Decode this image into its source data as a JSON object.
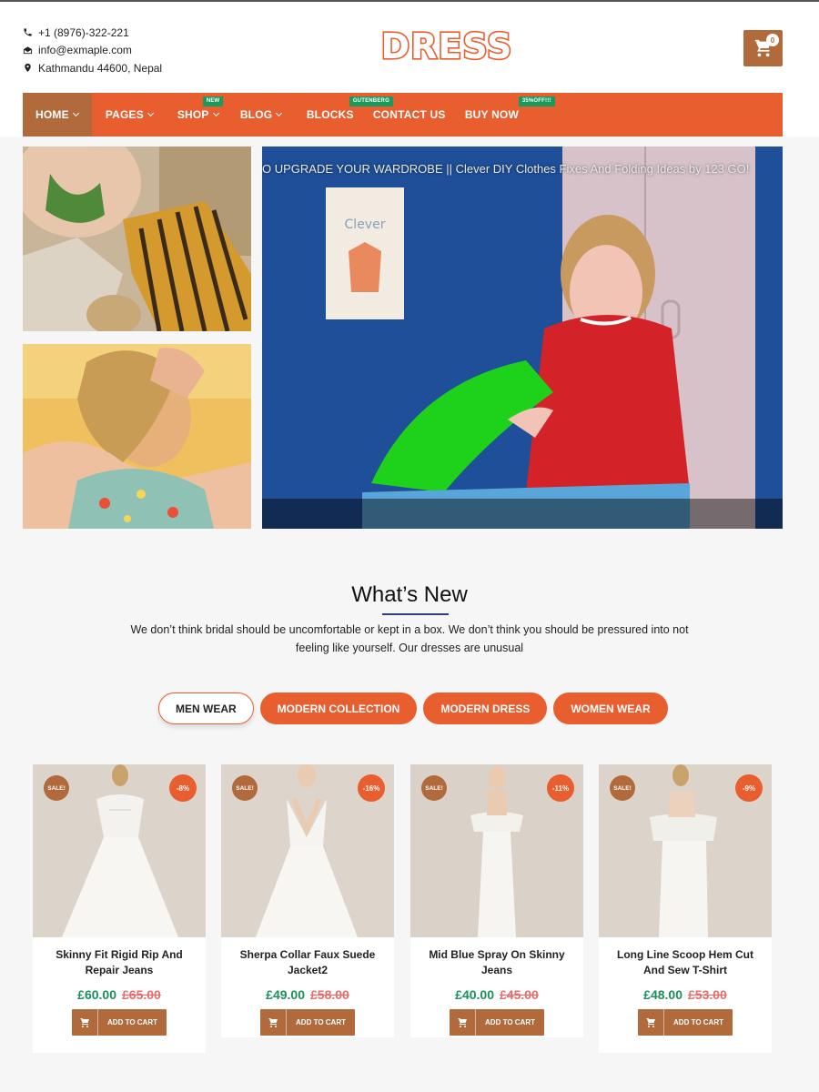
{
  "header": {
    "phone": "+1 (8976)-322-221",
    "email": "info@exmaple.com",
    "address": "Kathmandu 44600, Nepal",
    "logo_text": "DRESS",
    "cart_count": "0"
  },
  "nav": {
    "items": [
      {
        "label": "HOME",
        "dropdown": true,
        "badge": ""
      },
      {
        "label": "PAGES",
        "dropdown": true,
        "badge": ""
      },
      {
        "label": "SHOP",
        "dropdown": true,
        "badge": "NEW"
      },
      {
        "label": "BLOG",
        "dropdown": true,
        "badge": ""
      },
      {
        "label": "BLOCKS",
        "dropdown": false,
        "badge": "GUTENBERG"
      },
      {
        "label": "CONTACT US",
        "dropdown": false,
        "badge": ""
      },
      {
        "label": "BUY NOW",
        "dropdown": false,
        "badge": "35%OFF!!!"
      }
    ]
  },
  "video": {
    "title": "O UPGRADE YOUR WARDROBE || Clever DIY Clothes Fixes And Folding Ideas by 123 GO!",
    "poster_text": "Clever"
  },
  "whats_new": {
    "title": "What’s New",
    "description": "We don’t think bridal should be uncomfortable or kept in a box. We don’t think you should be pressured into not feeling like yourself. Our dresses are unusual"
  },
  "tabs": [
    {
      "label": "MEN WEAR",
      "active": true
    },
    {
      "label": "MODERN COLLECTION",
      "active": false
    },
    {
      "label": "MODERN DRESS",
      "active": false
    },
    {
      "label": "WOMEN WEAR",
      "active": false
    }
  ],
  "products": [
    {
      "name": "Skinny Fit Rigid Rip And Repair Jeans",
      "price": "£60.00",
      "old_price": "£65.00",
      "sale": "SALE!",
      "discount": "-8%"
    },
    {
      "name": "Sherpa Collar Faux Suede Jacket2",
      "price": "£49.00",
      "old_price": "£58.00",
      "sale": "SALE!",
      "discount": "-16%"
    },
    {
      "name": "Mid Blue Spray On Skinny Jeans",
      "price": "£40.00",
      "old_price": "£45.00",
      "sale": "SALE!",
      "discount": "-11%"
    },
    {
      "name": "Long Line Scoop Hem Cut And Sew T-Shirt",
      "price": "£48.00",
      "old_price": "£53.00",
      "sale": "SALE!",
      "discount": "-9%"
    }
  ],
  "add_to_cart_label": "ADD TO CART",
  "colors": {
    "brand_orange": "#e85e2e",
    "brown_accent": "#b06a3b",
    "price_green": "#1a8f5a",
    "old_price_red": "#e86a6a",
    "badge_green": "#1a9a5c"
  }
}
